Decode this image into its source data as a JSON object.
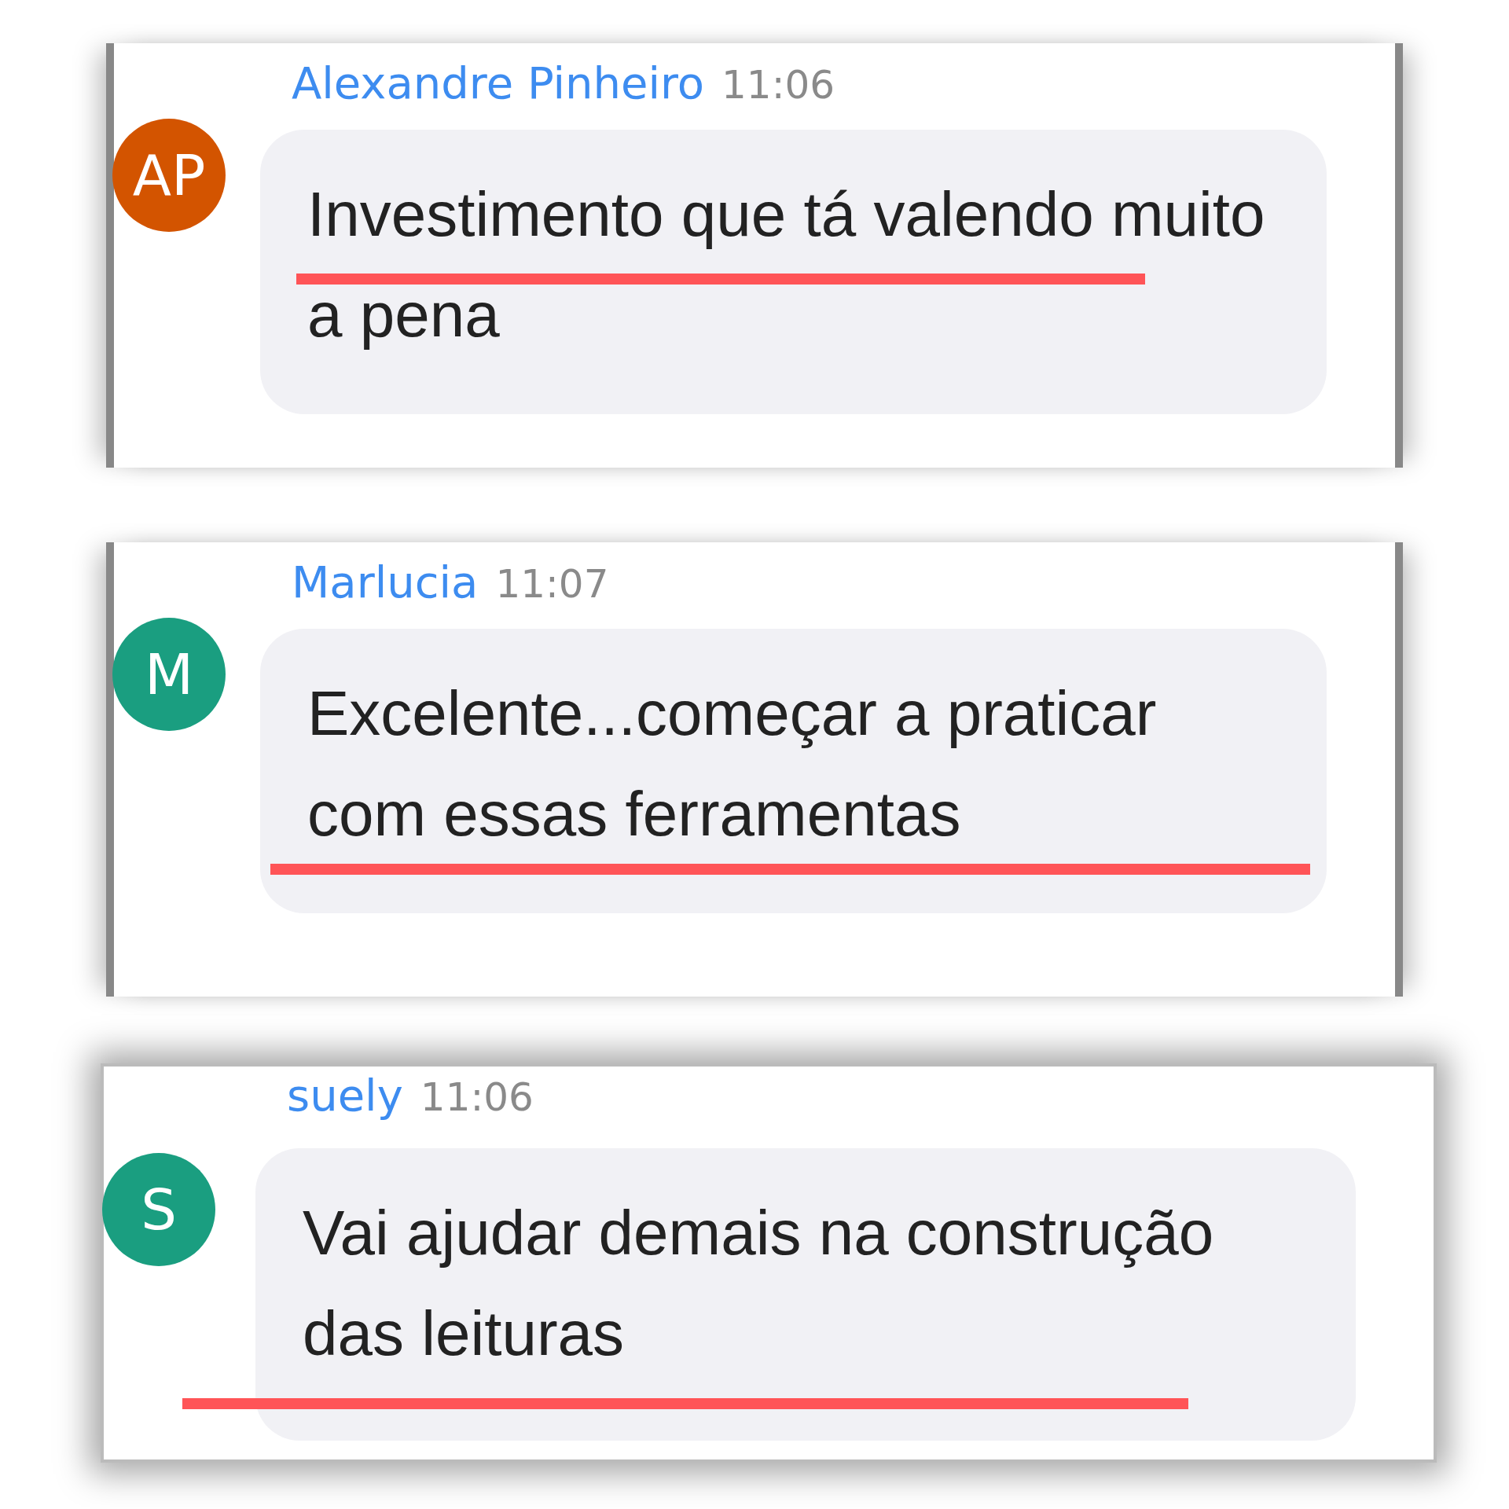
{
  "messages": [
    {
      "author": "Alexandre Pinheiro",
      "time": "11:06",
      "initials": "AP",
      "color": "#d35400",
      "text": "Investimento que tá valendo muito a pena",
      "underlined": true
    },
    {
      "author": "Marlucia",
      "time": "11:07",
      "initials": "M",
      "color": "#1a9e80",
      "text": "Excelente...começar a praticar com essas ferramentas",
      "underlined": true
    },
    {
      "author": "suely",
      "time": "11:06",
      "initials": "S",
      "color": "#1a9e80",
      "text": "Vai ajudar demais na construção das leituras",
      "underlined": true
    }
  ]
}
